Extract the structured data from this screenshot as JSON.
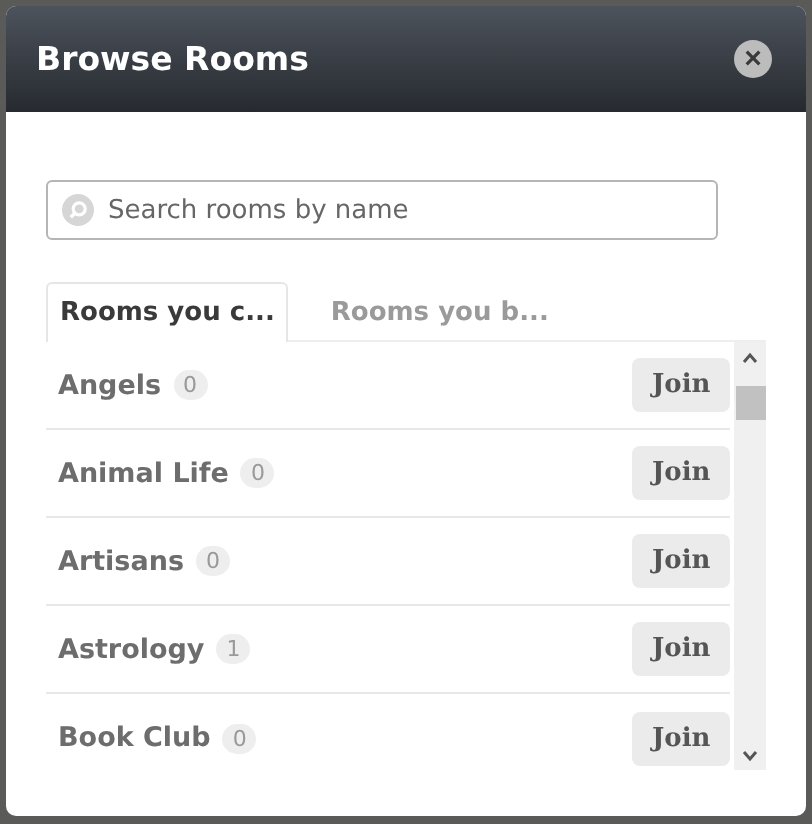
{
  "dialog": {
    "title": "Browse Rooms",
    "close": "×"
  },
  "search": {
    "placeholder": "Search rooms by name"
  },
  "tabs": [
    {
      "label": "Rooms you c...",
      "selected": true
    },
    {
      "label": "Rooms you b...",
      "selected": false
    }
  ],
  "rooms": [
    {
      "name": "Angels",
      "count": "0",
      "action": "Join"
    },
    {
      "name": "Animal Life",
      "count": "0",
      "action": "Join"
    },
    {
      "name": "Artisans",
      "count": "0",
      "action": "Join"
    },
    {
      "name": "Astrology",
      "count": "1",
      "action": "Join"
    },
    {
      "name": "Book Club",
      "count": "0",
      "action": "Join"
    }
  ]
}
